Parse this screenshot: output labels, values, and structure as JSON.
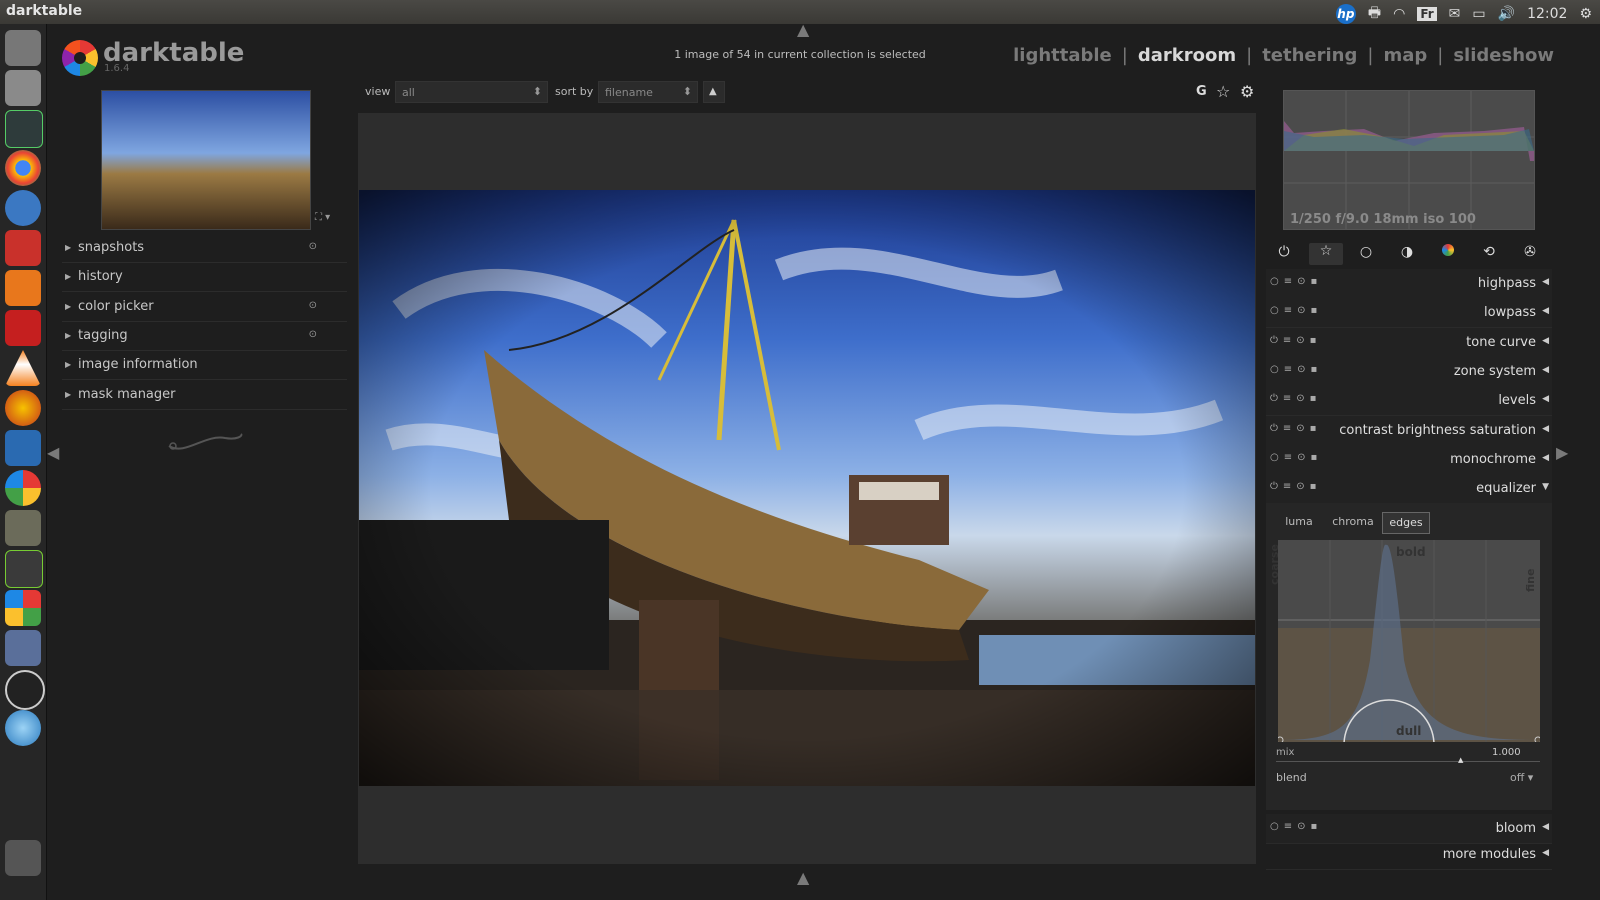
{
  "system": {
    "app_title": "darktable",
    "tray": {
      "hp": "hp",
      "fr": "Fr",
      "time": "12:02"
    }
  },
  "header": {
    "app_name": "darktable",
    "version": "1.6.4",
    "status": "1 image of 54 in current collection is selected",
    "views": [
      {
        "label": "lighttable",
        "active": false
      },
      {
        "label": "darkroom",
        "active": true
      },
      {
        "label": "tethering",
        "active": false
      },
      {
        "label": "map",
        "active": false
      },
      {
        "label": "slideshow",
        "active": false
      }
    ],
    "separator": "|"
  },
  "filterbar": {
    "view_label": "view",
    "view_value": "all",
    "sort_label": "sort by",
    "sort_value": "filename",
    "g_label": "G"
  },
  "left_modules": [
    {
      "label": "snapshots",
      "has_dot": true
    },
    {
      "label": "history",
      "has_dot": false
    },
    {
      "label": "color picker",
      "has_dot": true
    },
    {
      "label": "tagging",
      "has_dot": true
    },
    {
      "label": "image information",
      "has_dot": false
    },
    {
      "label": "mask manager",
      "has_dot": false
    }
  ],
  "exif": "1/250 f/9.0 18mm iso 100",
  "right_modules": [
    {
      "label": "highpass",
      "on": false
    },
    {
      "label": "lowpass",
      "on": false
    },
    {
      "label": "tone curve",
      "on": true
    },
    {
      "label": "zone system",
      "on": false
    },
    {
      "label": "levels",
      "on": true
    },
    {
      "label": "contrast brightness saturation",
      "on": true
    },
    {
      "label": "monochrome",
      "on": false
    },
    {
      "label": "equalizer",
      "on": true
    }
  ],
  "equalizer": {
    "tabs": [
      "luma",
      "chroma",
      "edges"
    ],
    "active_tab": "edges",
    "labels": {
      "bold": "bold",
      "dull": "dull",
      "coarse": "coarse",
      "fine": "fine"
    },
    "mix_label": "mix",
    "mix_value": "1.000",
    "blend_label": "blend",
    "blend_value": "off"
  },
  "bottom_modules": {
    "bloom": "bloom",
    "more": "more modules"
  },
  "colors": {
    "accent": "#d8d8d8",
    "panel": "#1e1e1e",
    "image_bg": "#2d2d2d"
  }
}
